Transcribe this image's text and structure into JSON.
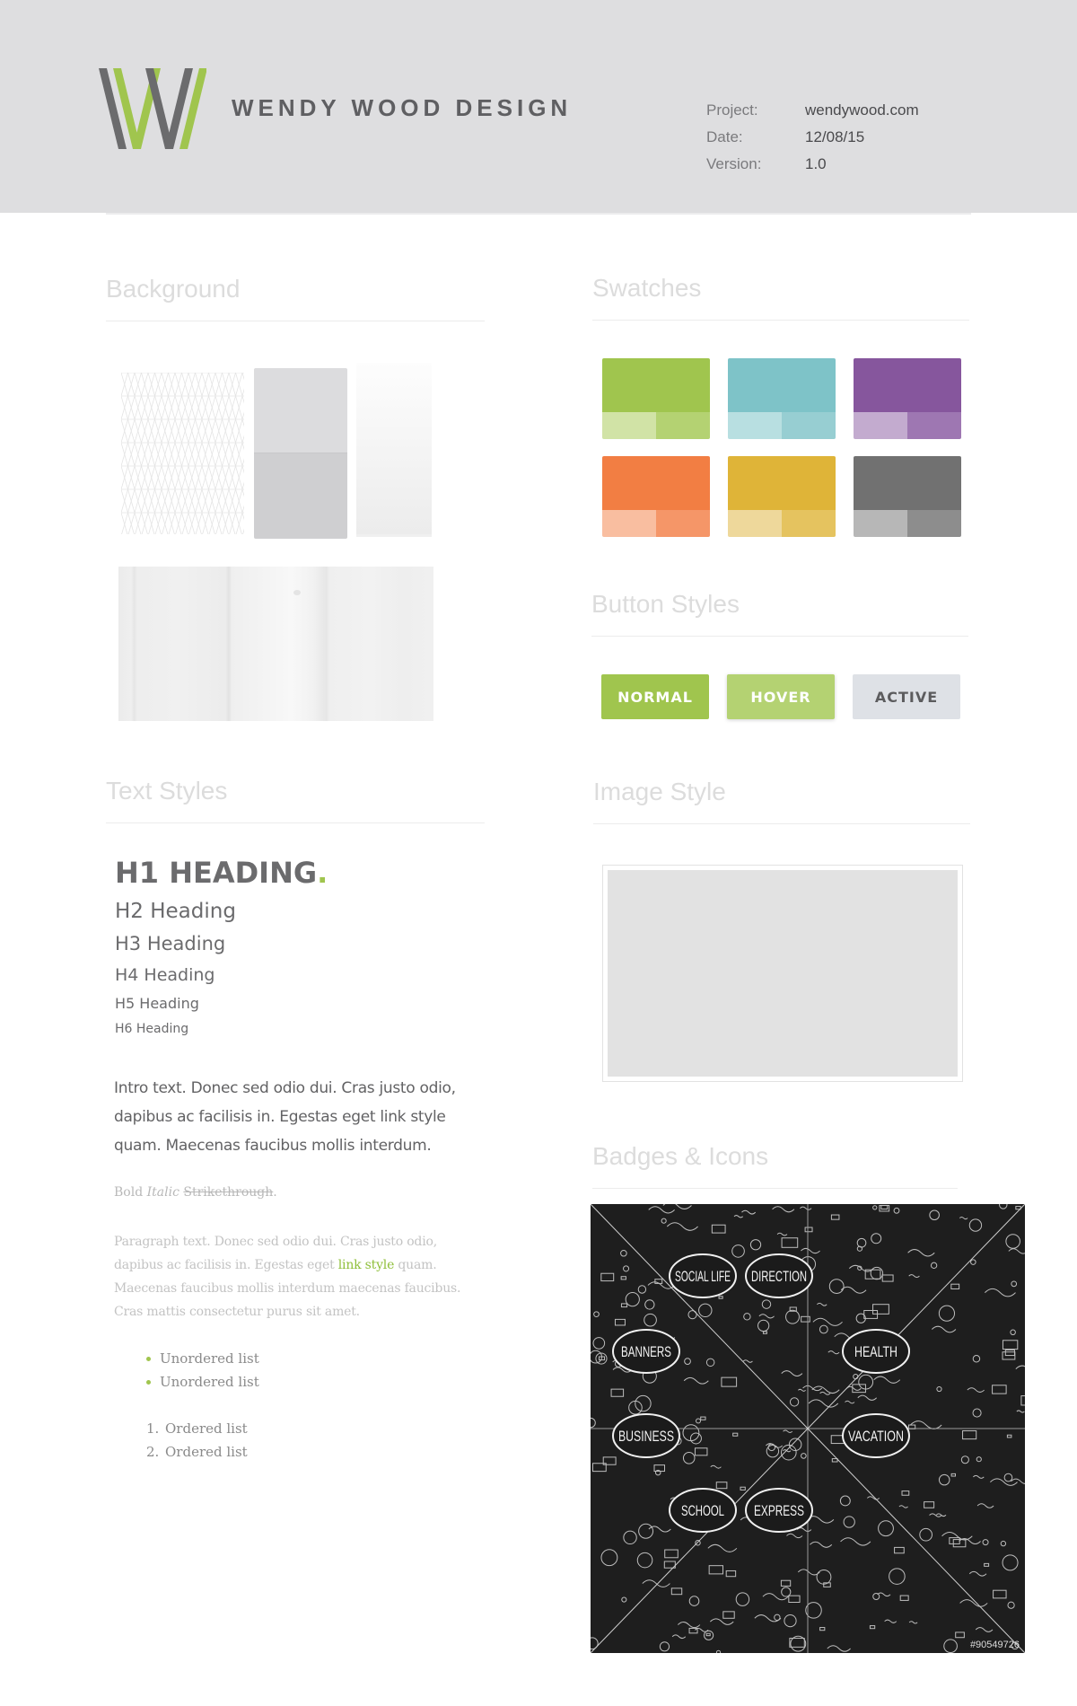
{
  "header": {
    "brand": "WENDY WOOD DESIGN",
    "logo_icon": "w-monogram-logo",
    "colors": {
      "background": "#dedee0",
      "logo_grey": "#6b6b6d",
      "logo_green": "#a0c54e"
    },
    "meta": [
      {
        "label": "Project:",
        "value": "wendywood.com"
      },
      {
        "label": "Date:",
        "value": "12/08/15"
      },
      {
        "label": "Version:",
        "value": "1.0"
      }
    ]
  },
  "sections": {
    "background": "Background",
    "swatches": "Swatches",
    "buttons": "Button Styles",
    "text": "Text Styles",
    "image": "Image Style",
    "badges": "Badges & Icons"
  },
  "background_samples": [
    {
      "name": "diamond-pattern"
    },
    {
      "name": "grey-solid",
      "colors": [
        "#dcdcde",
        "#cfcfd1"
      ]
    },
    {
      "name": "white-gradient",
      "colors": [
        "#fdfdfd",
        "#ececec"
      ]
    },
    {
      "name": "whitewashed-wood"
    }
  ],
  "swatches": [
    {
      "name": "green",
      "main": "#a0c54e",
      "tint1": "#d1e3a6",
      "tint2": "#b4d272"
    },
    {
      "name": "teal",
      "main": "#7ec3c8",
      "tint1": "#b8dfe1",
      "tint2": "#97ced2"
    },
    {
      "name": "purple",
      "main": "#86569d",
      "tint1": "#c3abcf",
      "tint2": "#9e77b2"
    },
    {
      "name": "orange",
      "main": "#f27e43",
      "tint1": "#f9bea0",
      "tint2": "#f59668"
    },
    {
      "name": "gold",
      "main": "#dfb438",
      "tint1": "#eed89b",
      "tint2": "#e5c35f"
    },
    {
      "name": "grey",
      "main": "#717171",
      "tint1": "#b7b7b7",
      "tint2": "#8d8d8d"
    }
  ],
  "buttons": {
    "normal": "NORMAL",
    "hover": "HOVER",
    "active": "ACTIVE"
  },
  "text_styles": {
    "h1": "H1 HEADING",
    "h1_dot": ".",
    "h2": "H2 Heading",
    "h3": "H3 Heading",
    "h4": "H4 Heading",
    "h5": "H5 Heading",
    "h6": "H6 Heading",
    "intro": "Intro text. Donec sed odio dui. Cras justo odio, dapibus ac facilisis in. Egestas eget link style quam. Maecenas faucibus mollis interdum.",
    "emphasis": {
      "bold": "Bold",
      "italic": "Italic",
      "strike": "Strikethrough",
      "end": "."
    },
    "paragraph": {
      "before": "Paragraph text. Donec sed odio dui. Cras justo odio, dapibus ac facilisis in. Egestas eget ",
      "link": "link style",
      "after": " quam. Maecenas faucibus mollis interdum maecenas faucibus. Cras mattis consectetur purus sit amet."
    },
    "unordered": [
      "Unordered list",
      "Unordered list"
    ],
    "ordered": [
      {
        "num": "1.",
        "text": "Ordered list"
      },
      {
        "num": "2.",
        "text": "Ordered list"
      }
    ],
    "accent_color": "#a0c54e"
  },
  "badges": {
    "labels": [
      "SOCIAL LIFE",
      "DIRECTION",
      "BANNERS",
      "HEALTH",
      "BUSINESS",
      "VACATION",
      "SCHOOL",
      "EXPRESS"
    ],
    "watermark": "#90549726"
  }
}
